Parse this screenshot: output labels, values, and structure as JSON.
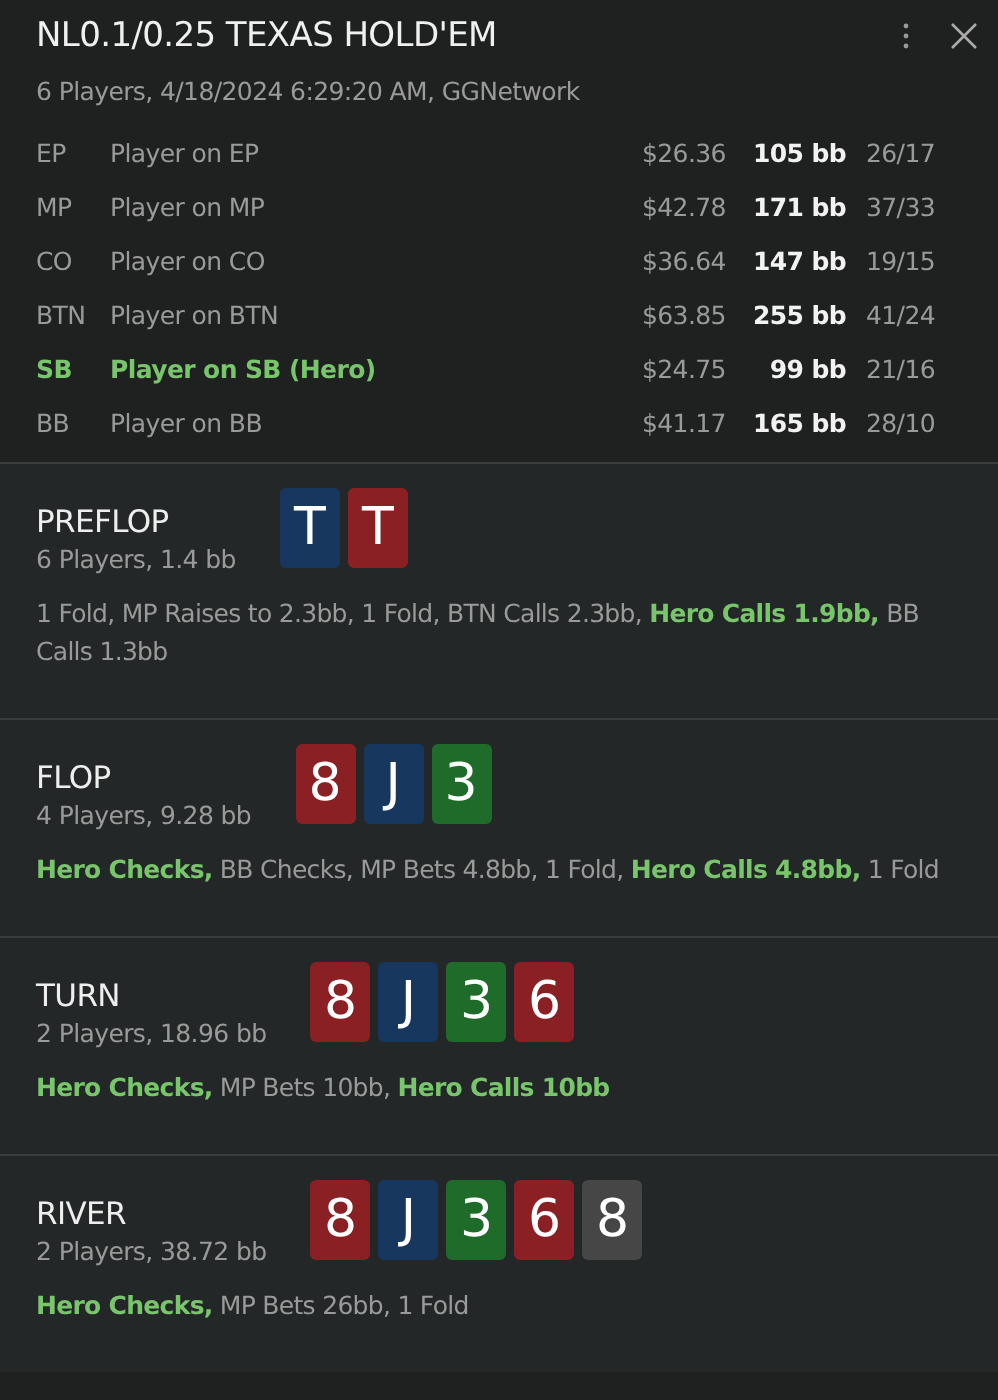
{
  "header": {
    "title": "NL0.1/0.25 TEXAS HOLD'EM",
    "subtitle": "6 Players, 4/18/2024 6:29:20 AM, GGNetwork"
  },
  "players": [
    {
      "position": "EP",
      "name": "Player on EP",
      "stack": "$26.36",
      "stack_bb": "105 bb",
      "stats": "26/17",
      "hero": false
    },
    {
      "position": "MP",
      "name": "Player on MP",
      "stack": "$42.78",
      "stack_bb": "171 bb",
      "stats": "37/33",
      "hero": false
    },
    {
      "position": "CO",
      "name": "Player on CO",
      "stack": "$36.64",
      "stack_bb": "147 bb",
      "stats": "19/15",
      "hero": false
    },
    {
      "position": "BTN",
      "name": "Player on BTN",
      "stack": "$63.85",
      "stack_bb": "255 bb",
      "stats": "41/24",
      "hero": false
    },
    {
      "position": "SB",
      "name": "Player on SB (Hero)",
      "stack": "$24.75",
      "stack_bb": "99 bb",
      "stats": "21/16",
      "hero": true
    },
    {
      "position": "BB",
      "name": "Player on BB",
      "stack": "$41.17",
      "stack_bb": "165 bb",
      "stats": "28/10",
      "hero": false
    }
  ],
  "streets": [
    {
      "name": "PREFLOP",
      "info": "6 Players, 1.4 bb",
      "cards": [
        {
          "rank": "T",
          "color": "#17375e"
        },
        {
          "rank": "T",
          "color": "#8a1f24"
        }
      ],
      "actions": "1 Fold, MP Raises to 2.3bb, 1 Fold, BTN Calls 2.3bb, **Hero Calls 1.9bb,** BB Calls 1.3bb"
    },
    {
      "name": "FLOP",
      "info": "4 Players, 9.28 bb",
      "cards": [
        {
          "rank": "8",
          "color": "#8a1f24"
        },
        {
          "rank": "J",
          "color": "#17375e"
        },
        {
          "rank": "3",
          "color": "#1e6b2a"
        }
      ],
      "actions": "**Hero Checks,** BB Checks, MP Bets 4.8bb, 1 Fold, **Hero Calls 4.8bb,** 1 Fold"
    },
    {
      "name": "TURN",
      "info": "2 Players, 18.96 bb",
      "cards": [
        {
          "rank": "8",
          "color": "#8a1f24"
        },
        {
          "rank": "J",
          "color": "#17375e"
        },
        {
          "rank": "3",
          "color": "#1e6b2a"
        },
        {
          "rank": "6",
          "color": "#8a1f24"
        }
      ],
      "actions": "**Hero Checks,** MP Bets 10bb, **Hero Calls 10bb**"
    },
    {
      "name": "RIVER",
      "info": "2 Players, 38.72 bb",
      "cards": [
        {
          "rank": "8",
          "color": "#8a1f24"
        },
        {
          "rank": "J",
          "color": "#17375e"
        },
        {
          "rank": "3",
          "color": "#1e6b2a"
        },
        {
          "rank": "6",
          "color": "#8a1f24"
        },
        {
          "rank": "8",
          "color": "#464646"
        }
      ],
      "actions": "**Hero Checks,** MP Bets 26bb, 1 Fold"
    }
  ]
}
